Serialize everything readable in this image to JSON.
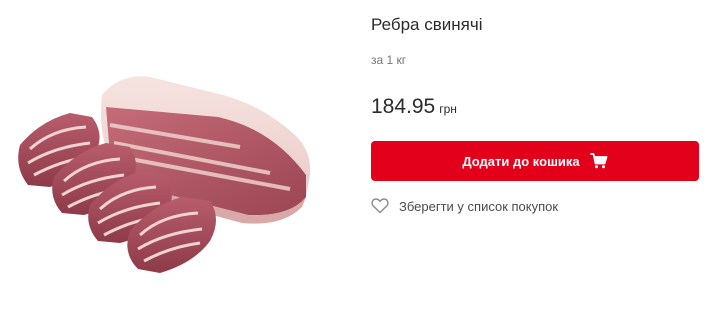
{
  "product": {
    "title": "Ребра свинячі",
    "unit": "за 1 кг",
    "price": "184.95",
    "currency": "грн",
    "image_alt": "Ребра свинячі"
  },
  "actions": {
    "add_to_cart_label": "Додати до кошика",
    "add_to_cart_icon": "cart-icon",
    "save_to_list_label": "Зберегти у список покупок",
    "save_to_list_icon": "heart-icon"
  },
  "colors": {
    "accent": "#e2001a",
    "text": "#2b2b2b",
    "muted": "#757575"
  }
}
